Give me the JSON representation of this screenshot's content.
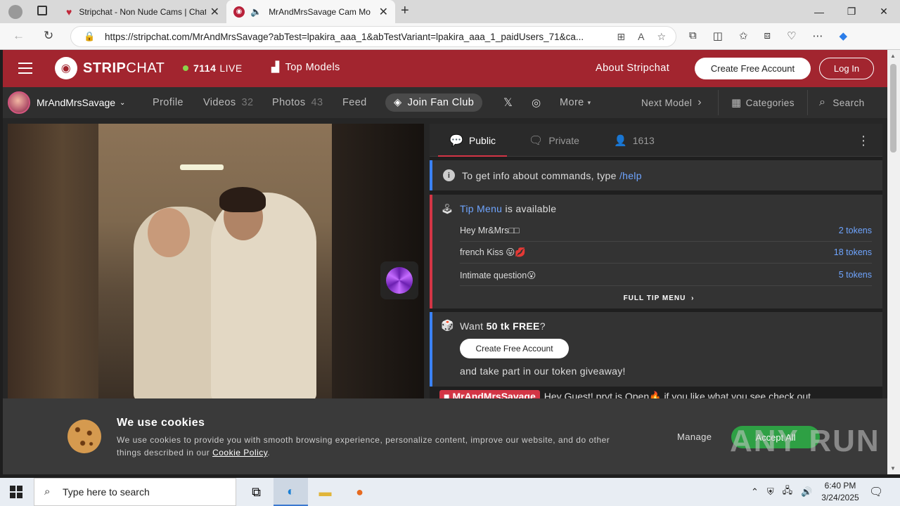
{
  "browser": {
    "tabs": [
      {
        "title": "Stripchat - Non Nude Cams | Chat",
        "active": false
      },
      {
        "title": "MrAndMrsSavage Cam Mo",
        "active": true
      }
    ],
    "url": "https://stripchat.com/MrAndMrsSavage?abTest=lpakira_aaa_1&abTestVariant=lpakira_aaa_1_paidUsers_71&ca..."
  },
  "header": {
    "logo_bold": "STRIP",
    "logo_thin": "CHAT",
    "live_count": "7114",
    "live_label": "LIVE",
    "top_models": "Top Models",
    "about": "About Stripchat",
    "create_account": "Create Free Account",
    "login": "Log In"
  },
  "subbar": {
    "username": "MrAndMrsSavage",
    "profile": "Profile",
    "videos": "Videos",
    "videos_count": "32",
    "photos": "Photos",
    "photos_count": "43",
    "feed": "Feed",
    "join_fan_club": "Join Fan Club",
    "more": "More",
    "next_model": "Next Model",
    "categories": "Categories",
    "search": "Search"
  },
  "chat": {
    "tab_public": "Public",
    "tab_private": "Private",
    "viewers": "1613",
    "info_text": "To get info about commands, type",
    "info_cmd": "/help",
    "tip_menu_link": "Tip Menu",
    "tip_menu_suffix": "is available",
    "tip_items": [
      {
        "name": "Hey Mr&Mrs□□",
        "price": "2 tokens"
      },
      {
        "name": "french Kiss 😛💋",
        "price": "18 tokens"
      },
      {
        "name": "Intimate question😮",
        "price": "5 tokens"
      }
    ],
    "full_tip_menu": "FULL TIP MENU",
    "free_prefix": "Want",
    "free_bold": "50 tk FREE",
    "free_suffix": "?",
    "free_button": "Create Free Account",
    "free_tail": "and take part in our token giveaway!",
    "model_tag": "MrAndMrsSavage",
    "model_msg": "Hey Guest! prvt is Open🔥 if you like what you see check out"
  },
  "cookie": {
    "title": "We use cookies",
    "text": "We use cookies to provide you with smooth browsing experience, personalize content, improve our website, and do other things described in our",
    "policy_link": "Cookie Policy",
    "manage": "Manage",
    "accept": "Accept All",
    "watermark": "ANY RUN"
  },
  "taskbar": {
    "search_placeholder": "Type here to search",
    "time": "6:40 PM",
    "date": "3/24/2025"
  },
  "colors": {
    "brand_red": "#a2252f",
    "accent_red": "#d33545",
    "link_blue": "#6fa5ff",
    "accept_green": "#2ea044"
  }
}
